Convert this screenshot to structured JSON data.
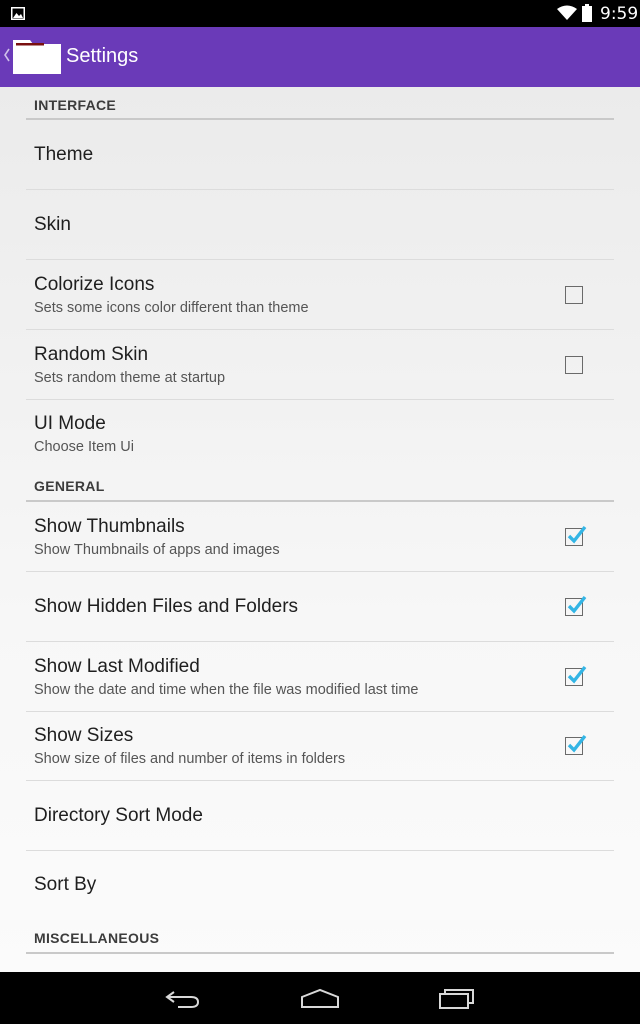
{
  "status_bar": {
    "time": "9:59",
    "icons": [
      "image-notification-icon",
      "wifi-icon",
      "battery-icon"
    ]
  },
  "action_bar": {
    "title": "Settings",
    "icons": [
      "up-chevron-icon",
      "folder-icon"
    ],
    "accent_color": "#6a3ab8"
  },
  "sections": {
    "interface": {
      "header": "INTERFACE",
      "items": [
        {
          "title": "Theme",
          "summary": ""
        },
        {
          "title": "Skin",
          "summary": ""
        },
        {
          "title": "Colorize Icons",
          "summary": "Sets some icons color different than theme",
          "checked": false
        },
        {
          "title": "Random Skin",
          "summary": "Sets random theme at startup",
          "checked": false
        },
        {
          "title": "UI Mode",
          "summary": "Choose Item Ui"
        }
      ]
    },
    "general": {
      "header": "GENERAL",
      "items": [
        {
          "title": "Show Thumbnails",
          "summary": "Show Thumbnails of apps and images",
          "checked": true
        },
        {
          "title": "Show Hidden Files and Folders",
          "summary": "",
          "checked": true
        },
        {
          "title": "Show Last Modified",
          "summary": "Show the date and time when the file was modified last time",
          "checked": true
        },
        {
          "title": "Show Sizes",
          "summary": "Show size of files and number of items in folders",
          "checked": true
        },
        {
          "title": "Directory Sort Mode",
          "summary": ""
        },
        {
          "title": "Sort By",
          "summary": ""
        }
      ]
    },
    "misc": {
      "header": "MISCELLANEOUS"
    }
  },
  "check_color": "#33b5e5",
  "nav_bar": {
    "icons": [
      "back-icon",
      "home-icon",
      "recent-apps-icon"
    ]
  }
}
